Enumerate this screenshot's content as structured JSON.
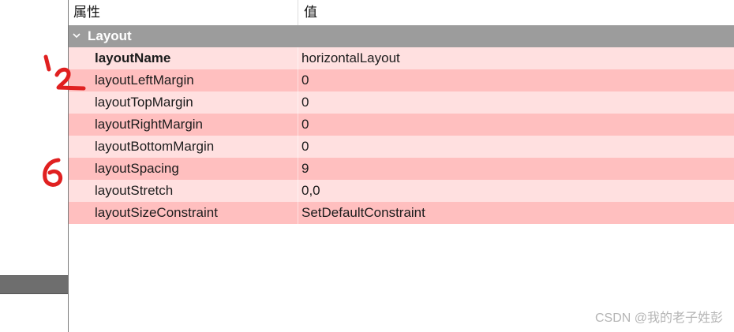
{
  "header": {
    "property_label": "属性",
    "value_label": "值"
  },
  "group": {
    "label": "Layout",
    "icon": "chevron-down-icon"
  },
  "rows": [
    {
      "name": "layoutName",
      "value": "horizontalLayout",
      "bold": true
    },
    {
      "name": "layoutLeftMargin",
      "value": "0"
    },
    {
      "name": "layoutTopMargin",
      "value": "0"
    },
    {
      "name": "layoutRightMargin",
      "value": "0"
    },
    {
      "name": "layoutBottomMargin",
      "value": "0"
    },
    {
      "name": "layoutSpacing",
      "value": "9"
    },
    {
      "name": "layoutStretch",
      "value": "0,0"
    },
    {
      "name": "layoutSizeConstraint",
      "value": "SetDefaultConstraint"
    }
  ],
  "annotations": {
    "mark_1": "1",
    "mark_2": "2",
    "mark_6": "6",
    "color": "#e02020"
  },
  "watermark": "CSDN @我的老子姓彭",
  "colors": {
    "row_light": "#ffe0e0",
    "row_dark": "#ffbfbf",
    "group_bg": "#9c9c9c"
  }
}
